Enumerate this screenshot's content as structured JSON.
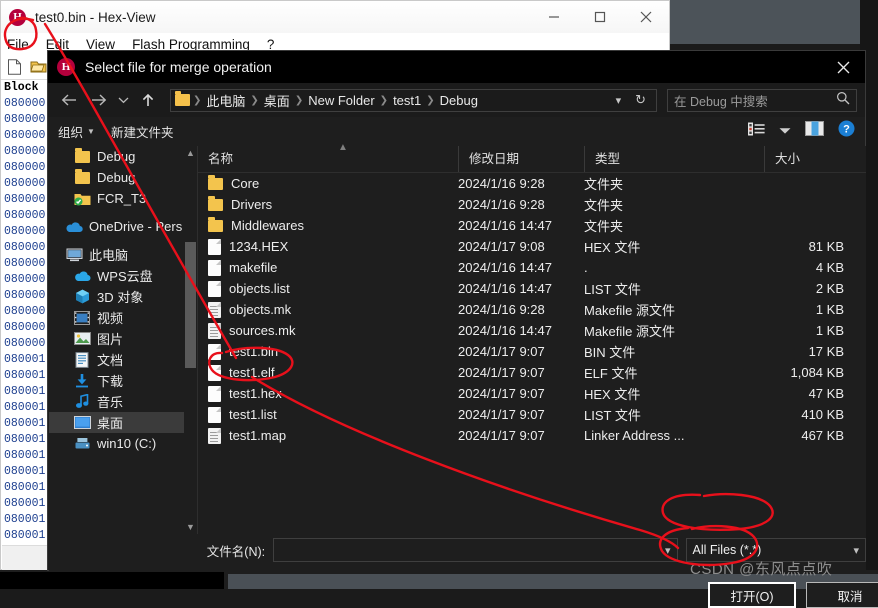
{
  "hex_app": {
    "title": "test0.bin - Hex-View",
    "logo_letter": "H",
    "menu": [
      "File",
      "Edit",
      "View",
      "Flash Programming",
      "?"
    ],
    "window_controls": [
      "minimize-icon",
      "maximize-icon",
      "close-icon"
    ],
    "hex_header": "Block",
    "hex_addresses": [
      "080000",
      "080000",
      "080000",
      "080000",
      "080000",
      "080000",
      "080000",
      "080000",
      "080000",
      "080000",
      "080000",
      "080000",
      "080000",
      "080000",
      "080000",
      "080000",
      "080001",
      "080001",
      "080001",
      "080001",
      "080001",
      "080001",
      "080001",
      "080001",
      "080001",
      "080001",
      "080001",
      "080001",
      "080001",
      "080001"
    ]
  },
  "dialog": {
    "title": "Select file for merge operation",
    "logo_letter": "H",
    "close_icon": "close-icon",
    "nav": {
      "back_icon": "arrow-left-icon",
      "forward_icon": "arrow-right-icon",
      "recent_icon": "chevron-down-icon",
      "up_icon": "arrow-up-icon",
      "breadcrumb": [
        "此电脑",
        "桌面",
        "New Folder",
        "test1",
        "Debug"
      ],
      "breadcrumb_caret": "chevron-down-icon",
      "refresh_icon": "refresh-icon",
      "search_placeholder": "在 Debug 中搜索",
      "search_icon": "search-icon"
    },
    "toolbar": {
      "organize": "组织",
      "new_folder": "新建文件夹",
      "view_icon": "list-view-icon",
      "view_caret": "chevron-down-icon",
      "preview_icon": "preview-pane-icon",
      "help_icon": "help-icon"
    },
    "tree": {
      "items": [
        {
          "label": "Debug",
          "icon": "folder-icon",
          "indent": 2,
          "selected": false
        },
        {
          "label": "Debug",
          "icon": "folder-icon",
          "indent": 2,
          "selected": false
        },
        {
          "label": "FCR_T3",
          "icon": "folder-sync-icon",
          "indent": 2,
          "selected": false
        },
        {
          "label": "",
          "icon": "",
          "indent": 1,
          "selected": false
        },
        {
          "label": "OneDrive - Pers",
          "icon": "onedrive-icon",
          "indent": 1,
          "selected": false
        },
        {
          "label": "",
          "icon": "",
          "indent": 1,
          "selected": false
        },
        {
          "label": "此电脑",
          "icon": "this-pc-icon",
          "indent": 1,
          "selected": false
        },
        {
          "label": "WPS云盘",
          "icon": "wps-cloud-icon",
          "indent": 2,
          "selected": false
        },
        {
          "label": "3D 对象",
          "icon": "3d-objects-icon",
          "indent": 2,
          "selected": false
        },
        {
          "label": "视频",
          "icon": "videos-icon",
          "indent": 2,
          "selected": false
        },
        {
          "label": "图片",
          "icon": "pictures-icon",
          "indent": 2,
          "selected": false
        },
        {
          "label": "文档",
          "icon": "documents-icon",
          "indent": 2,
          "selected": false
        },
        {
          "label": "下载",
          "icon": "downloads-icon",
          "indent": 2,
          "selected": false
        },
        {
          "label": "音乐",
          "icon": "music-icon",
          "indent": 2,
          "selected": false
        },
        {
          "label": "桌面",
          "icon": "desktop-icon",
          "indent": 2,
          "selected": true
        },
        {
          "label": "win10 (C:)",
          "icon": "drive-icon",
          "indent": 2,
          "selected": false
        }
      ],
      "scroll_up_icon": "chevron-up-icon",
      "scroll_down_icon": "chevron-down-icon"
    },
    "file_list": {
      "columns": [
        "名称",
        "修改日期",
        "类型",
        "大小"
      ],
      "sort_indicator": "sort-asc-icon",
      "rows": [
        {
          "name": "Core",
          "icon": "folder-icon",
          "date": "2024/1/16 9:28",
          "type": "文件夹",
          "size": ""
        },
        {
          "name": "Drivers",
          "icon": "folder-icon",
          "date": "2024/1/16 9:28",
          "type": "文件夹",
          "size": ""
        },
        {
          "name": "Middlewares",
          "icon": "folder-icon",
          "date": "2024/1/16 14:47",
          "type": "文件夹",
          "size": ""
        },
        {
          "name": "1234.HEX",
          "icon": "file-icon",
          "date": "2024/1/17 9:08",
          "type": "HEX 文件",
          "size": "81 KB"
        },
        {
          "name": "makefile",
          "icon": "file-icon",
          "date": "2024/1/16 14:47",
          "type": ".",
          "size": "4 KB"
        },
        {
          "name": "objects.list",
          "icon": "file-icon",
          "date": "2024/1/16 14:47",
          "type": "LIST 文件",
          "size": "2 KB"
        },
        {
          "name": "objects.mk",
          "icon": "file-lines-icon",
          "date": "2024/1/16 9:28",
          "type": "Makefile 源文件",
          "size": "1 KB"
        },
        {
          "name": "sources.mk",
          "icon": "file-lines-icon",
          "date": "2024/1/16 14:47",
          "type": "Makefile 源文件",
          "size": "1 KB"
        },
        {
          "name": "test1.bin",
          "icon": "file-icon",
          "date": "2024/1/17 9:07",
          "type": "BIN 文件",
          "size": "17 KB"
        },
        {
          "name": "test1.elf",
          "icon": "file-icon",
          "date": "2024/1/17 9:07",
          "type": "ELF 文件",
          "size": "1,084 KB"
        },
        {
          "name": "test1.hex",
          "icon": "file-icon",
          "date": "2024/1/17 9:07",
          "type": "HEX 文件",
          "size": "47 KB"
        },
        {
          "name": "test1.list",
          "icon": "file-icon",
          "date": "2024/1/17 9:07",
          "type": "LIST 文件",
          "size": "410 KB"
        },
        {
          "name": "test1.map",
          "icon": "file-lines-icon",
          "date": "2024/1/17 9:07",
          "type": "Linker Address ...",
          "size": "467 KB"
        }
      ]
    },
    "footer": {
      "filename_label": "文件名(N):",
      "filename_value": "",
      "filename_caret": "chevron-down-icon",
      "filetype_value": "All Files (*.*)",
      "filetype_caret": "chevron-down-icon",
      "open_button": "打开(O)",
      "cancel_button": "取消"
    }
  },
  "watermark": "CSDN @东风点点吹",
  "colors": {
    "accent_red": "#e8101b",
    "brand_crimson": "#b4003c",
    "folder_yellow": "#f3c44d",
    "dialog_bg": "#1e1e1e",
    "selection": "#3b3b3b"
  }
}
